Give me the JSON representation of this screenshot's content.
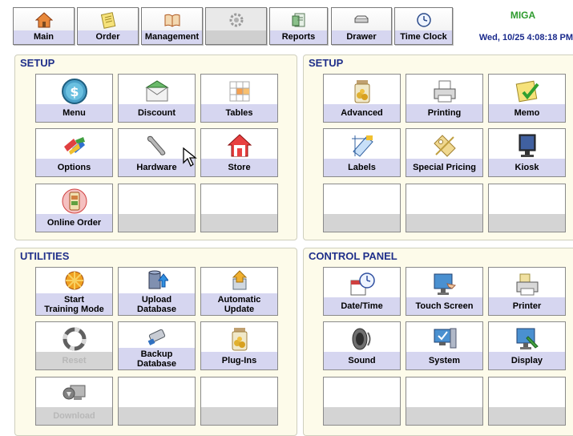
{
  "toolbar": {
    "main": "Main",
    "order": "Order",
    "management": "Management",
    "blank": "",
    "reports": "Reports",
    "drawer": "Drawer",
    "time_clock": "Time Clock"
  },
  "brand": "MIGA",
  "datetime": "Wed, 10/25 4:08:18 PM",
  "panels": {
    "setup_left": {
      "title": "SETUP",
      "tiles": [
        "Menu",
        "Discount",
        "Tables",
        "Options",
        "Hardware",
        "Store",
        "Online Order"
      ]
    },
    "setup_right": {
      "title": "SETUP",
      "tiles": [
        "Advanced",
        "Printing",
        "Memo",
        "Labels",
        "Special Pricing",
        "Kiosk"
      ]
    },
    "utilities": {
      "title": "UTILITIES",
      "tiles": {
        "training_1": "Start",
        "training_2": "Training Mode",
        "upload_1": "Upload",
        "upload_2": "Database",
        "auto_1": "Automatic",
        "auto_2": "Update",
        "reset": "Reset",
        "backup_1": "Backup",
        "backup_2": "Database",
        "plugins": "Plug-Ins",
        "download": "Download"
      }
    },
    "control_panel": {
      "title": "CONTROL PANEL",
      "tiles": [
        "Date/Time",
        "Touch Screen",
        "Printer",
        "Sound",
        "System",
        "Display"
      ]
    }
  },
  "colors": {
    "label_band": "#d6d6f0",
    "panel_bg": "#fdfbea",
    "title_blue": "#1f2f8a",
    "brand_green": "#2e9b2e"
  }
}
